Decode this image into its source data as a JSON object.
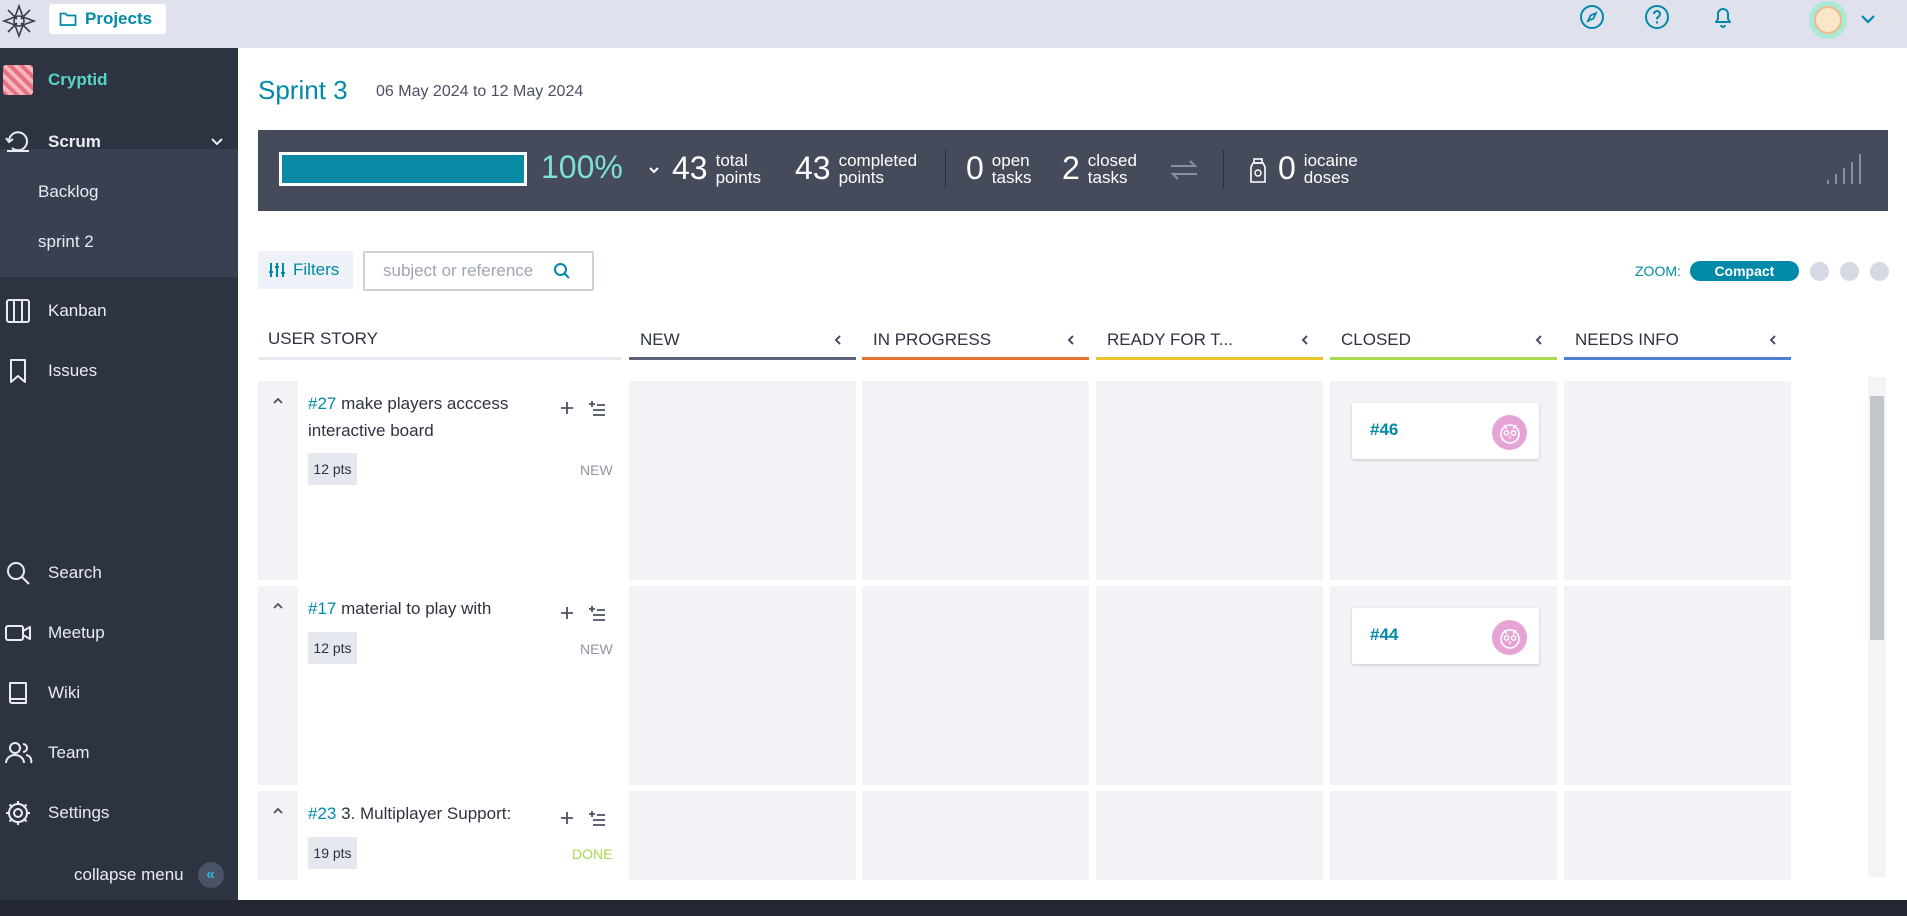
{
  "topbar": {
    "projects_label": "Projects",
    "icons": [
      "logo-icon",
      "folder-icon",
      "compass-icon",
      "help-icon",
      "bell-icon",
      "user-avatar",
      "chevron-down-icon"
    ]
  },
  "sidebar": {
    "project_name": "Cryptid",
    "scrum_label": "Scrum",
    "sub_items": [
      {
        "label": "Backlog"
      },
      {
        "label": "sprint 2"
      }
    ],
    "items": [
      {
        "label": "Kanban",
        "icon": "kanban-icon"
      },
      {
        "label": "Issues",
        "icon": "bookmark-icon"
      },
      {
        "label": "Search",
        "icon": "search-icon"
      },
      {
        "label": "Meetup",
        "icon": "video-icon"
      },
      {
        "label": "Wiki",
        "icon": "book-icon"
      },
      {
        "label": "Team",
        "icon": "team-icon"
      },
      {
        "label": "Settings",
        "icon": "gear-icon"
      }
    ],
    "collapse_label": "collapse menu"
  },
  "sprint": {
    "title": "Sprint 3",
    "dates": "06 May 2024 to 12 May 2024"
  },
  "summary": {
    "progress_fraction": 1.0,
    "percent": "100%",
    "total_points": "43",
    "total_points_label": [
      "total",
      "points"
    ],
    "completed_points": "43",
    "completed_points_label": [
      "completed",
      "points"
    ],
    "open_tasks": "0",
    "open_tasks_label": [
      "open",
      "tasks"
    ],
    "closed_tasks": "2",
    "closed_tasks_label": [
      "closed",
      "tasks"
    ],
    "iocaine": "0",
    "iocaine_label": [
      "iocaine",
      "doses"
    ]
  },
  "toolbar": {
    "filters_label": "Filters",
    "search_placeholder": "subject or reference",
    "zoom_label": "ZOOM:",
    "zoom_value": "Compact"
  },
  "board": {
    "user_story_header": "USER STORY",
    "columns": [
      {
        "label": "NEW",
        "color": "#5c6277"
      },
      {
        "label": "IN PROGRESS",
        "color": "#e4742f"
      },
      {
        "label": "READY FOR T...",
        "color": "#e8c52c"
      },
      {
        "label": "CLOSED",
        "color": "#a8d84c"
      },
      {
        "label": "NEEDS INFO",
        "color": "#4a7fd4"
      }
    ],
    "stories": [
      {
        "ref": "#27",
        "title": "make players acccess interactive board",
        "points": "12 pts",
        "status": "NEW",
        "status_color": "#8f96a3",
        "closed_task": "#46"
      },
      {
        "ref": "#17",
        "title": "material to play with",
        "points": "12 pts",
        "status": "NEW",
        "status_color": "#8f96a3",
        "closed_task": "#44"
      },
      {
        "ref": "#23",
        "title": "3. Multiplayer Support:",
        "points": "19 pts",
        "status": "DONE",
        "status_color": "#a8d84c",
        "closed_task": ""
      }
    ]
  },
  "colors": {
    "accent": "#008aa8",
    "sidebar_bg": "#2e3342",
    "summary_bg": "#464b5c",
    "percent": "#7de0d7"
  }
}
